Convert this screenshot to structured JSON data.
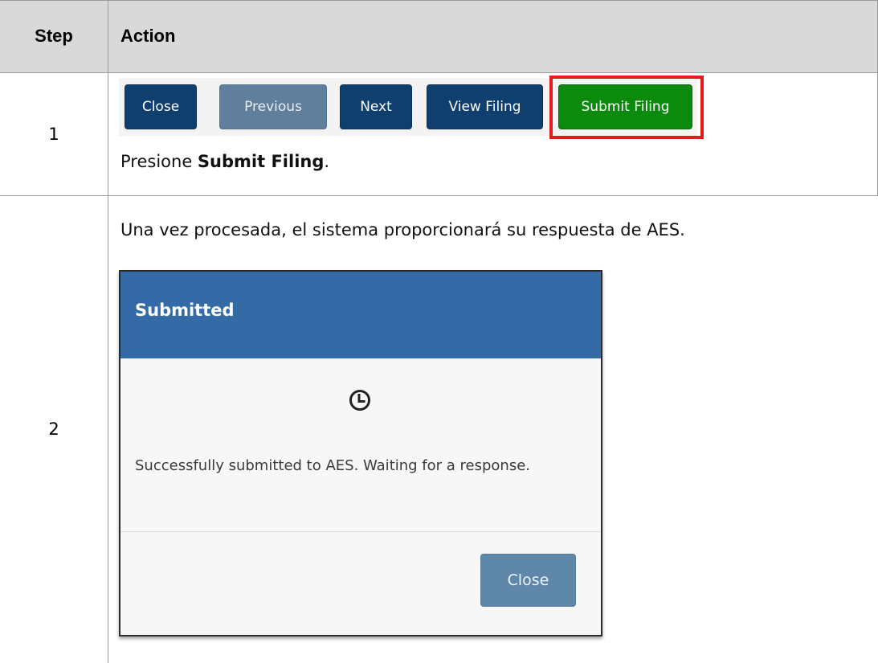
{
  "table": {
    "headers": {
      "step": "Step",
      "action": "Action"
    },
    "rows": [
      {
        "step": "1",
        "buttons": {
          "close": "Close",
          "previous": "Previous",
          "next": "Next",
          "view_filing": "View Filing",
          "submit_filing": "Submit Filing"
        },
        "instruction_prefix": "Presione ",
        "instruction_bold": "Submit Filing",
        "instruction_suffix": "."
      },
      {
        "step": "2",
        "paragraph": "Una vez procesada, el sistema proporcionará su respuesta de AES.",
        "modal": {
          "title": "Submitted",
          "icon": "clock-icon",
          "message": "Successfully submitted to AES. Waiting for a response.",
          "close_label": "Close"
        }
      }
    ]
  },
  "colors": {
    "header_bg": "#d9d9d9",
    "navy_button": "#0f3f6e",
    "disabled_button": "#5f7f9c",
    "submit_button": "#0b8a0e",
    "highlight": "#e31b1b",
    "modal_header": "#346aa5"
  }
}
